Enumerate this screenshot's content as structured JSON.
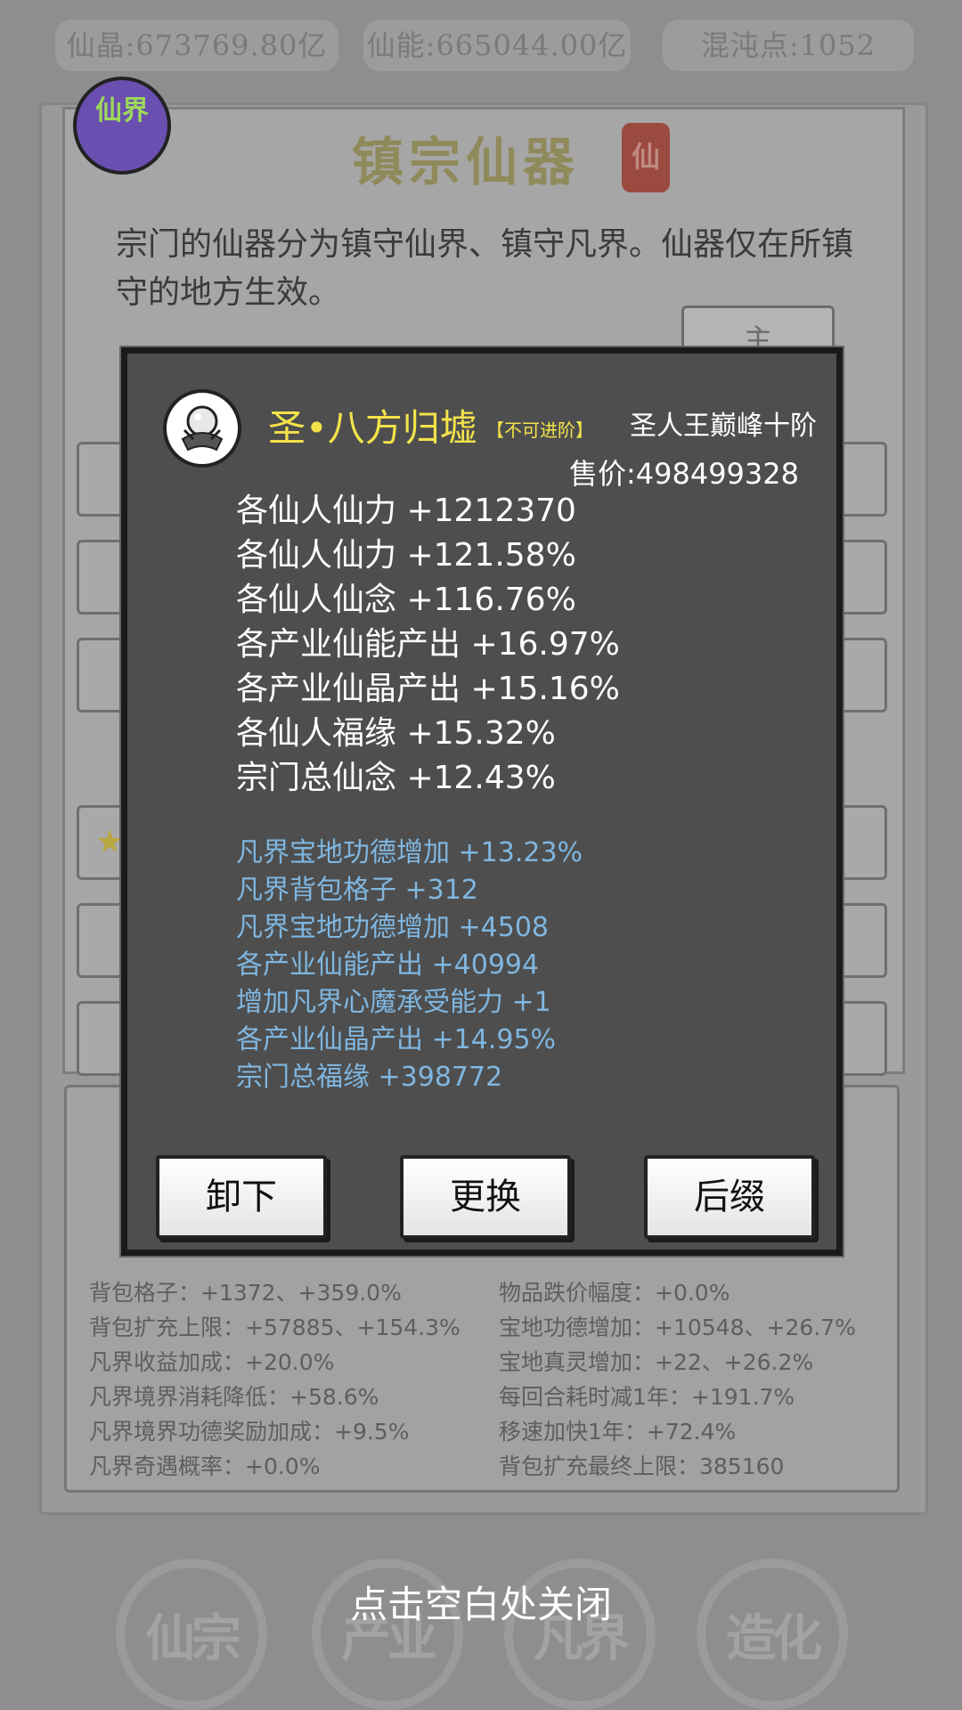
{
  "top_bar": {
    "crystal": "仙晶:673769.80亿",
    "energy": "仙能:665044.00亿",
    "chaos": "混沌点:1052"
  },
  "background": {
    "realm_badge": "仙界",
    "title": "镇宗仙器",
    "seal_char": "仙",
    "description": "宗门的仙器分为镇守仙界、镇守凡界。仙器仅在所镇守的地方生效。",
    "top_button_partial": "主",
    "stats_left": [
      "背包格子：+1372、+359.0%",
      "背包扩充上限：+57885、+154.3%",
      "凡界收益加成：+20.0%",
      "凡界境界消耗降低：+58.6%",
      "凡界境界功德奖励加成：+9.5%",
      "凡界奇遇概率：+0.0%"
    ],
    "stats_right": [
      "物品跌价幅度：+0.0%",
      "宝地功德增加：+10548、+26.7%",
      "宝地真灵增加：+22、+26.2%",
      "每回合耗时减1年：+191.7%",
      "移速加快1年：+72.4%",
      "背包扩充最终上限：385160"
    ],
    "nav": [
      "仙宗",
      "产业",
      "凡界",
      "造化"
    ]
  },
  "modal": {
    "item_name": "圣•八方归墟",
    "item_tag": "【不可进阶】",
    "item_rank": "圣人王巅峰十阶",
    "price": "售价:498499328",
    "main_stats": [
      "各仙人仙力 +1212370",
      "各仙人仙力 +121.58%",
      "各仙人仙念 +116.76%",
      "各产业仙能产出 +16.97%",
      "各产业仙晶产出 +15.16%",
      "各仙人福缘 +15.32%",
      "宗门总仙念 +12.43%"
    ],
    "extra_stats": [
      "凡界宝地功德增加 +13.23%",
      "凡界背包格子 +312",
      "凡界宝地功德增加 +4508",
      "各产业仙能产出 +40994",
      "增加凡界心魔承受能力 +1",
      "各产业仙晶产出 +14.95%",
      "宗门总福缘 +398772"
    ],
    "buttons": {
      "unequip": "卸下",
      "replace": "更换",
      "suffix": "后缀"
    }
  },
  "close_hint": "点击空白处关闭",
  "colors": {
    "item_name": "#f3e24a",
    "extra_stat": "#7fb6e0",
    "modal_bg": "#4e4e4e"
  }
}
